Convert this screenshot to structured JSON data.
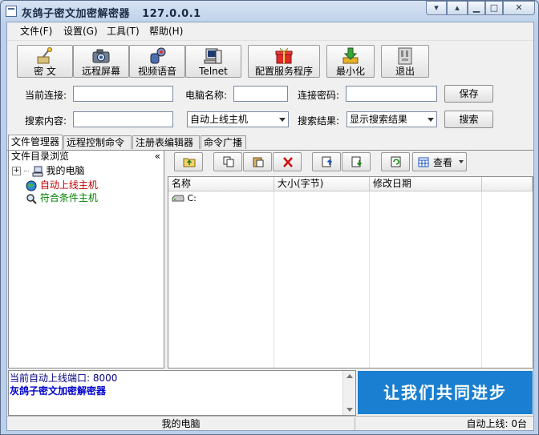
{
  "window": {
    "title": "灰鸽子密文加密解密器",
    "title_ip": "127.0.0.1"
  },
  "menu": [
    {
      "label": "文件(F)"
    },
    {
      "label": "设置(G)"
    },
    {
      "label": "工具(T)"
    },
    {
      "label": "帮助(H)"
    }
  ],
  "toolbar": [
    {
      "label": "密 文",
      "icon": "key-icon"
    },
    {
      "label": "远程屏幕",
      "icon": "camera-icon"
    },
    {
      "label": "视频语音",
      "icon": "microphone-icon"
    },
    {
      "label": "Telnet",
      "icon": "terminal-icon"
    },
    {
      "label": "配置服务程序",
      "icon": "gift-box-icon"
    },
    {
      "label": "最小化",
      "icon": "download-arrow-icon"
    },
    {
      "label": "退出",
      "icon": "exit-door-icon"
    }
  ],
  "connection": {
    "current_label": "当前连接:",
    "current_value": "",
    "computer_name_label": "电脑名称:",
    "computer_name_value": "",
    "password_label": "连接密码:",
    "password_value": "",
    "save_label": "保存"
  },
  "search": {
    "content_label": "搜索内容:",
    "content_value": "",
    "scope_value": "自动上线主机",
    "result_label": "搜索结果:",
    "result_value": "显示搜索结果",
    "search_label": "搜索"
  },
  "tabs": [
    {
      "label": "文件管理器",
      "active": true
    },
    {
      "label": "远程控制命令",
      "active": false
    },
    {
      "label": "注册表编辑器",
      "active": false
    },
    {
      "label": "命令广播",
      "active": false
    }
  ],
  "tree": {
    "header": "文件目录浏览",
    "collapse_glyph": "«",
    "items": [
      {
        "label": "我的电脑",
        "color": "#000000"
      },
      {
        "label": "自动上线主机",
        "color": "#c00000"
      },
      {
        "label": "符合条件主机",
        "color": "#008000"
      }
    ]
  },
  "file_toolbar": {
    "view_label": "查看"
  },
  "file_list": {
    "columns": [
      "名称",
      "大小(字节)",
      "修改日期"
    ],
    "rows": [
      {
        "name": "C:"
      }
    ]
  },
  "log": {
    "line1": "当前自动上线端口: 8000",
    "line2": "灰鸽子密文加密解密器"
  },
  "banner": {
    "text": "让我们共同进步"
  },
  "status": {
    "left": "我的电脑",
    "right_label": "自动上线:",
    "right_value": "0台"
  },
  "colors": {
    "title_bg": "#c9d7ea",
    "banner_bg": "#1a7fd0",
    "log_line1": "#000080",
    "log_line2": "#0000cc"
  }
}
